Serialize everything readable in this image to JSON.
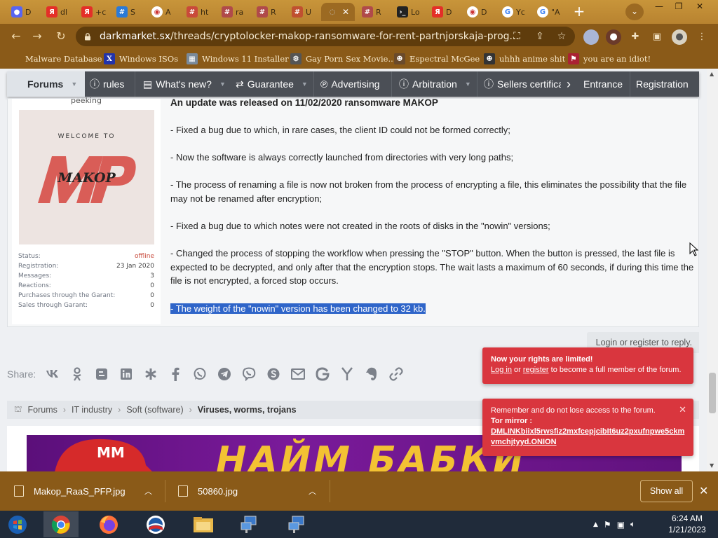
{
  "browser": {
    "tabs": [
      {
        "favicon": "discord-icon",
        "label": "D",
        "color": "#5865f2",
        "active": false
      },
      {
        "favicon": "yandex-icon",
        "label": "dl",
        "color": "#e42f28",
        "active": false
      },
      {
        "favicon": "yandex-icon",
        "label": "+c",
        "color": "#e42f28",
        "active": false
      },
      {
        "favicon": "grid-icon",
        "label": "S",
        "color": "#2a7ad8",
        "active": false
      },
      {
        "favicon": "chrome-icon",
        "label": "A",
        "color": "#ffffff",
        "active": false
      },
      {
        "favicon": "hashtag-icon",
        "label": "ht",
        "color": "#c94a3a",
        "active": false
      },
      {
        "favicon": "hashtag-icon",
        "label": "ra",
        "color": "#b04a4a",
        "active": false
      },
      {
        "favicon": "hashtag-icon",
        "label": "R",
        "color": "#b04a4a",
        "active": false
      },
      {
        "favicon": "hashtag-icon",
        "label": "U",
        "color": "#c05030",
        "active": false
      },
      {
        "favicon": "spinner-icon",
        "label": "",
        "color": "#666",
        "active": true
      },
      {
        "favicon": "hashtag-icon",
        "label": "R",
        "color": "#b04a4a",
        "active": false
      },
      {
        "favicon": "terminal-icon",
        "label": "Lo",
        "color": "#222222",
        "active": false
      },
      {
        "favicon": "yandex-icon",
        "label": "D",
        "color": "#e42f28",
        "active": false
      },
      {
        "favicon": "chrome-icon",
        "label": "D",
        "color": "#ffffff",
        "active": false
      },
      {
        "favicon": "google-icon",
        "label": "Yc",
        "color": "#ffffff",
        "active": false
      },
      {
        "favicon": "google-icon",
        "label": "\"A",
        "color": "#ffffff",
        "active": false
      }
    ],
    "url_host": "darkmarket.sx",
    "url_path": "/threads/cryptolocker-makop-ransomware-for-rent-partnjorskaja-prog...",
    "bookmarks": [
      {
        "icon": "malware-icon",
        "label": "Malware Database",
        "color": "#8a5a18"
      },
      {
        "icon": "x-icon",
        "label": "Windows ISOs",
        "color": "#2233aa"
      },
      {
        "icon": "installer-icon",
        "label": "Windows 11 Installer",
        "color": "#7a8a9a"
      },
      {
        "icon": "gear-icon",
        "label": "Gay Porn Sex Movie...",
        "color": "#555"
      },
      {
        "icon": "avatar-icon",
        "label": "Espectral McGee",
        "color": "#6a4a2a"
      },
      {
        "icon": "avatar-icon",
        "label": "uhhh anime shit",
        "color": "#333"
      },
      {
        "icon": "flag-icon",
        "label": "you are an idiot!",
        "color": "#aa2233"
      }
    ]
  },
  "forum_nav": {
    "items": [
      {
        "icon": "",
        "label": "Forums",
        "caret": true
      },
      {
        "icon": "rules-icon",
        "label": "rules",
        "caret": false
      },
      {
        "icon": "news-icon",
        "label": "What's new?",
        "caret": true
      },
      {
        "icon": "handshake-icon",
        "label": "Guarantee",
        "caret": true
      },
      {
        "icon": "ad-icon",
        "label": "Advertising",
        "caret": false
      },
      {
        "icon": "arbitration-icon",
        "label": "Arbitration",
        "caret": true
      },
      {
        "icon": "certificate-icon",
        "label": "Sellers certifica",
        "caret": false
      }
    ],
    "entrance": "Entrance",
    "registration": "Registration"
  },
  "user": {
    "title": "peeking",
    "avatar_welcome": "WELCOME TO",
    "avatar_logo": "MAKOP",
    "stats": [
      {
        "label": "Status:",
        "value": "offline"
      },
      {
        "label": "Registration:",
        "value": "23 Jan 2020"
      },
      {
        "label": "Messages:",
        "value": "3"
      },
      {
        "label": "Reactions:",
        "value": "0"
      },
      {
        "label": "Purchases through the Garant:",
        "value": "0"
      },
      {
        "label": "Sales through Garant:",
        "value": "0"
      }
    ]
  },
  "post": {
    "title": "An update was released on 11/02/2020 ransomware MAKOP",
    "p1": "- Fixed a bug due to which, in rare cases, the client ID could not be formed correctly;",
    "p2": "- Now the software is always correctly launched from directories with very long paths;",
    "p3": "- The process of renaming a file is now not broken from the process of encrypting a file, this eliminates the possibility that the file may not be renamed after encryption;",
    "p4": "- Fixed a bug due to which notes were not created in the roots of disks in the \"nowin\" versions;",
    "p5": "- Changed the process of stopping the workflow when pressing the \"STOP\" button. When the button is pressed, the last file is expected to be decrypted, and only after that the encryption stops. The wait lasts a maximum of 60 seconds, if during this time the file is not encrypted, a forced stop occurs.",
    "p6": "- The weight of the \"nowin\" version has been changed to 32 kb."
  },
  "reply": {
    "label": "Login or register to reply."
  },
  "share": {
    "label": "Share:"
  },
  "breadcrumbs": {
    "items": [
      "Forums",
      "IT industry",
      "Soft (software)",
      "Viruses, worms, trojans"
    ]
  },
  "banner": {
    "text": "НАЙМ БАБКИ"
  },
  "toasts": {
    "rights_title": "Now your rights are limited!",
    "rights_login": "Log in",
    "rights_or": "or",
    "rights_register": "register",
    "rights_rest": "to become a full member of the forum.",
    "mirror_line1": "Remember and do not lose access to the forum.",
    "mirror_title": "Tor mirror :",
    "mirror_link": "DMLINKbiixl5rwsfiz2mxfcepjcibIt6uz2pxufnpwe5ckmvmchjtyyd.ONION"
  },
  "downloads": {
    "files": [
      "Makop_RaaS_PFP.jpg",
      "50860.jpg"
    ],
    "show_all": "Show all"
  },
  "taskbar": {
    "time": "6:24 AM",
    "date": "1/21/2023"
  }
}
